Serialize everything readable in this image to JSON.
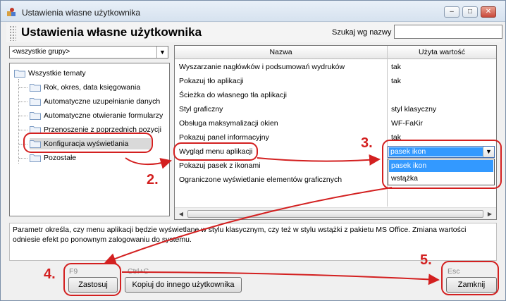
{
  "window": {
    "title": "Ustawienia własne użytkownika",
    "buttons": {
      "minimize": "–",
      "maximize": "□",
      "close": "✕"
    }
  },
  "header": {
    "title": "Ustawienia własne użytkownika",
    "search_label": "Szukaj wg nazwy",
    "search_value": ""
  },
  "group_select": {
    "selected": "<wszystkie grupy>",
    "arrow": "▼"
  },
  "tree": {
    "root": "Wszystkie tematy",
    "children": [
      "Rok, okres, data księgowania",
      "Automatyczne uzupełnianie danych",
      "Automatyczne otwieranie formularzy",
      "Przenoszenie z poprzednich pozycji",
      "Konfiguracja wyświetlania",
      "Pozostałe"
    ],
    "selected_index": 4
  },
  "grid": {
    "columns": [
      "Nazwa",
      "Użyta wartość"
    ],
    "rows": [
      {
        "name": "Wyszarzanie nagłówków i podsumowań wydruków",
        "value": "tak"
      },
      {
        "name": "Pokazuj tło aplikacji",
        "value": "tak"
      },
      {
        "name": "Ścieżka do własnego tła aplikacji",
        "value": ""
      },
      {
        "name": "Styl graficzny",
        "value": "styl klasyczny"
      },
      {
        "name": "Obsługa maksymalizacji okien",
        "value": "WF-FaKir"
      },
      {
        "name": "Pokazuj panel informacyjny",
        "value": "tak"
      },
      {
        "name": "Wygląd menu aplikacji",
        "value": ""
      },
      {
        "name": "Pokazuj pasek z ikonami",
        "value": ""
      },
      {
        "name": "Ograniczone wyświetlanie elementów graficznych",
        "value": ""
      }
    ],
    "combo": {
      "selected": "pasek ikon",
      "options": [
        "pasek ikon",
        "wstążka"
      ]
    }
  },
  "description": "Parametr określa, czy menu aplikacji będzie wyświetlane w stylu klasycznym, czy też w stylu wstążki z pakietu MS Office. Zmiana wartości odniesie efekt po ponownym zalogowaniu do systemu.",
  "footer": {
    "apply": {
      "shortcut": "F9",
      "label": "Zastosuj"
    },
    "copy": {
      "shortcut": "Ctrl+C",
      "label": "Kopiuj do innego użytkownika"
    },
    "close": {
      "shortcut": "Esc",
      "label": "Zamknij"
    }
  },
  "annotations": [
    "2.",
    "3.",
    "4.",
    "5."
  ],
  "colors": {
    "annotation": "#d32020",
    "selection": "#3399ff"
  }
}
